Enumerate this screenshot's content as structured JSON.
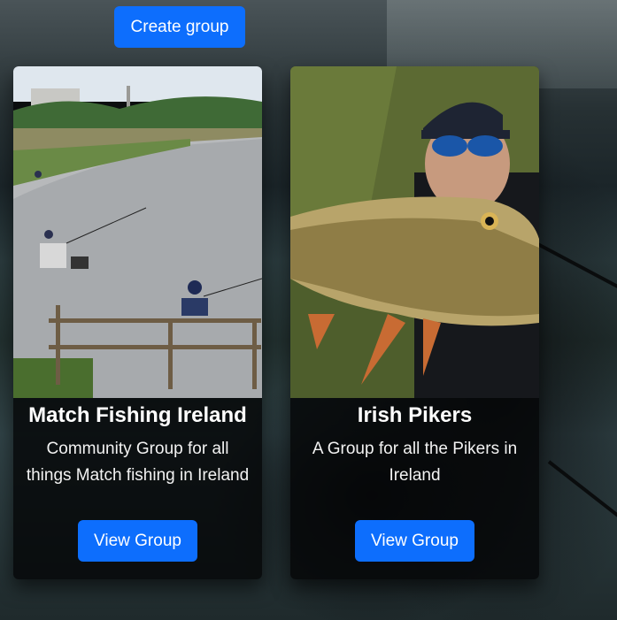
{
  "header": {
    "create_group_label": "Create group"
  },
  "groups": [
    {
      "title": "Match Fishing Ireland",
      "description": "Community Group for all things Match fishing in Ireland",
      "button_label": "View Group",
      "image_icon": "match-fishing-photo"
    },
    {
      "title": "Irish Pikers",
      "description": "A Group for all the Pikers in Ireland",
      "button_label": "View Group",
      "image_icon": "pike-angler-photo"
    }
  ],
  "colors": {
    "primary": "#0d6efd",
    "card_bg": "#050607"
  }
}
